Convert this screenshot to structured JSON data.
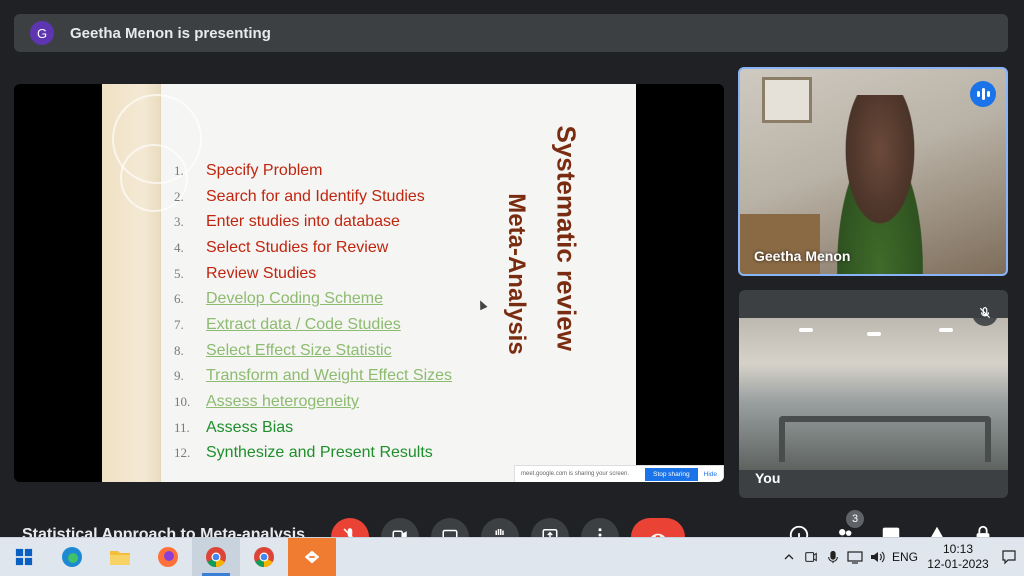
{
  "banner": {
    "avatar_letter": "G",
    "text": "Geetha Menon is presenting"
  },
  "slide": {
    "title_vertical_1": "Systematic review",
    "title_vertical_2": "Meta-Analysis",
    "items": [
      {
        "num": "1.",
        "text": "Specify Problem",
        "style": "red"
      },
      {
        "num": "2.",
        "text": "Search for and Identify Studies",
        "style": "red"
      },
      {
        "num": "3.",
        "text": "Enter studies into database",
        "style": "red"
      },
      {
        "num": "4.",
        "text": "Select Studies for Review",
        "style": "red"
      },
      {
        "num": "5.",
        "text": "Review Studies",
        "style": "red"
      },
      {
        "num": "6.",
        "text": "Develop Coding Scheme",
        "style": "link"
      },
      {
        "num": "7.",
        "text": "Extract data / Code Studies",
        "style": "link"
      },
      {
        "num": "8.",
        "text": "Select Effect Size Statistic",
        "style": "link"
      },
      {
        "num": "9.",
        "text": "Transform and Weight Effect Sizes",
        "style": "link"
      },
      {
        "num": "10.",
        "text": "Assess heterogeneity",
        "style": "link"
      },
      {
        "num": "11.",
        "text": "Assess Bias",
        "style": "green"
      },
      {
        "num": "12.",
        "text": "Synthesize and Present Results",
        "style": "green"
      }
    ],
    "share_bar": {
      "message": "meet.google.com is sharing your screen.",
      "stop_label": "Stop sharing",
      "hide_label": "Hide"
    }
  },
  "participants": {
    "presenter_name": "Geetha Menon",
    "self_name": "You"
  },
  "controls": {
    "meeting_title": "Statistical Approach to Meta-analysis",
    "people_count": "3"
  },
  "taskbar": {
    "language": "ENG",
    "time": "10:13",
    "date": "12-01-2023"
  },
  "colors": {
    "accent": "#1a73e8",
    "danger": "#ea4335",
    "slide_red": "#c0250f",
    "slide_link": "#8dbb6f",
    "slide_green": "#1f8f2b"
  }
}
